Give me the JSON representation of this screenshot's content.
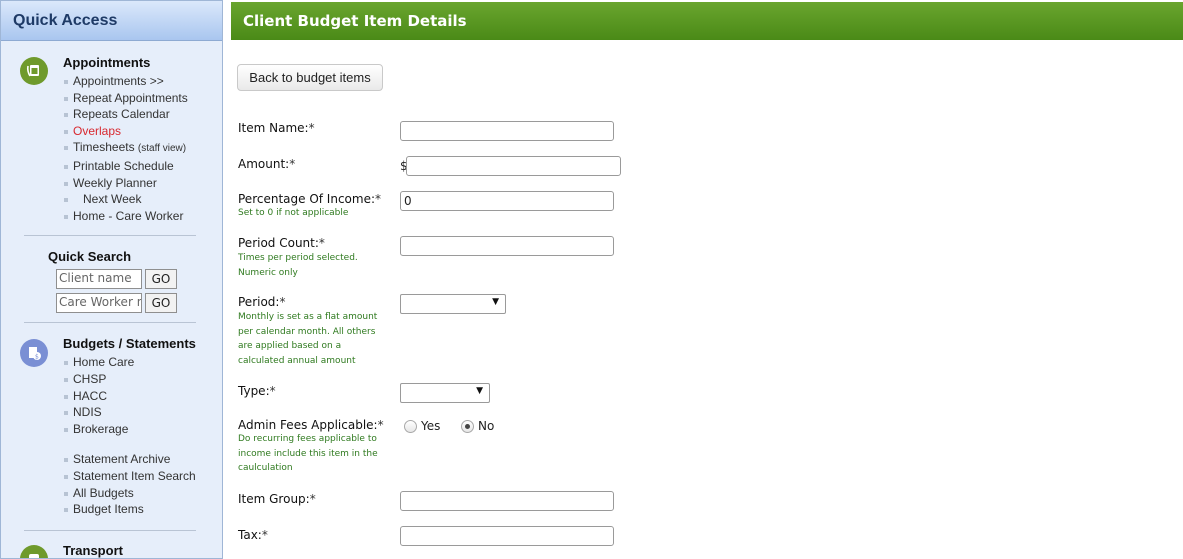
{
  "sidebar": {
    "title": "Quick Access",
    "appointments": {
      "title": "Appointments",
      "icon": "phone-calendar-icon",
      "color": "#6f9a2c",
      "links": [
        "Appointments >>",
        "Repeat Appointments",
        "Repeats Calendar",
        "Overlaps",
        "Timesheets",
        "Printable Schedule",
        "Weekly Planner",
        "Next Week",
        "Home - Care Worker"
      ],
      "timesheets_suffix": "(staff view)"
    },
    "quick_search": {
      "title": "Quick Search",
      "client_placeholder": "Client name",
      "worker_placeholder": "Care Worker n",
      "go_label": "GO"
    },
    "budgets": {
      "title": "Budgets / Statements",
      "icon": "budget-document-icon",
      "color": "#6f8fd6",
      "links": [
        "Home Care",
        "CHSP",
        "HACC",
        "NDIS",
        "Brokerage"
      ],
      "links2": [
        "Statement Archive",
        "Statement Item Search",
        "All Budgets",
        "Budget Items"
      ]
    },
    "transport": {
      "title": "Transport",
      "icon": "transport-icon",
      "color": "#6f9a2c"
    }
  },
  "main": {
    "title": "Client Budget Item Details",
    "back_label": "Back to budget items",
    "fields": {
      "item_name": {
        "label": "Item Name:",
        "value": ""
      },
      "amount": {
        "label": "Amount:",
        "prefix": "$",
        "value": ""
      },
      "percentage": {
        "label": "Percentage Of Income:",
        "hint": "Set to 0 if not applicable",
        "value": "0"
      },
      "period_count": {
        "label": "Period Count:",
        "hint": "Times per period selected. Numeric only",
        "value": ""
      },
      "period": {
        "label": "Period:",
        "hint": "Monthly is set as a flat amount per calendar month. All others are applied based on a calculated annual amount",
        "value": ""
      },
      "type": {
        "label": "Type:",
        "value": ""
      },
      "admin_fees": {
        "label": "Admin Fees Applicable:",
        "hint": "Do recurring fees applicable to income include this item in the caulculation",
        "yes": "Yes",
        "no": "No",
        "selected": "No"
      },
      "item_group": {
        "label": "Item Group:",
        "value": ""
      },
      "tax": {
        "label": "Tax:",
        "value": ""
      }
    },
    "required_mark": "*"
  }
}
